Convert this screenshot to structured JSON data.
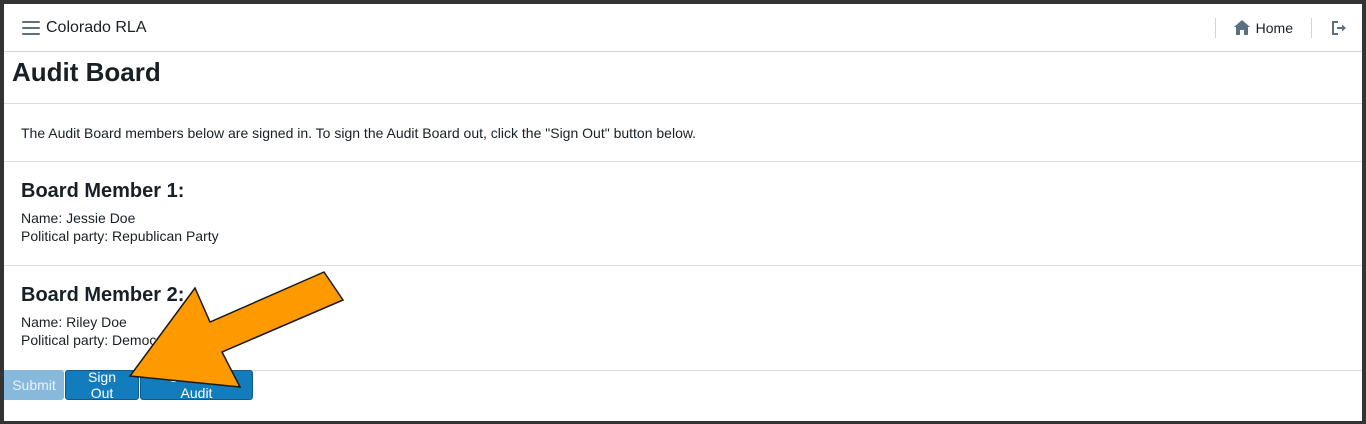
{
  "navbar": {
    "brand": "Colorado RLA",
    "home_label": "Home",
    "menu_icon": "hamburger-menu-icon",
    "home_icon": "home-icon",
    "logout_icon": "logout-icon"
  },
  "page": {
    "title": "Audit Board",
    "intro": "The Audit Board members below are signed in. To sign the Audit Board out, click the \"Sign Out\" button below."
  },
  "members": [
    {
      "heading": "Board Member 1:",
      "name": "Name: Jessie Doe",
      "party": "Political party: Republican Party"
    },
    {
      "heading": "Board Member 2:",
      "name": "Name: Riley Doe",
      "party": "Political party: Democratic Party"
    }
  ],
  "buttons": {
    "submit": "Submit",
    "sign_out": "Sign Out",
    "continue": "Continue Audit"
  },
  "colors": {
    "primary": "#137cbd",
    "disabled": "#86b9dc",
    "annotation_arrow": "#ff9900"
  }
}
